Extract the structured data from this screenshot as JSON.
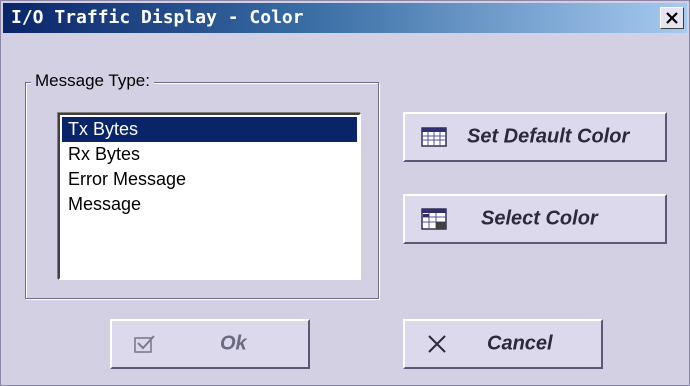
{
  "window": {
    "title": "I/O Traffic Display - Color"
  },
  "group": {
    "label": "Message Type:"
  },
  "list": {
    "items": [
      "Tx Bytes",
      "Rx Bytes",
      "Error Message",
      "Message"
    ],
    "selected": "Tx Bytes"
  },
  "buttons": {
    "set_default_color": "Set Default Color",
    "select_color": "Select Color",
    "ok": "Ok",
    "cancel": "Cancel"
  },
  "icons": {
    "close": "close-icon",
    "set_default_color": "color-grid-icon",
    "select_color": "color-grid-select-icon",
    "ok": "checkmark-icon",
    "cancel": "x-icon"
  },
  "colors": {
    "title_start": "#0a246a",
    "title_end": "#a6caf0",
    "dialog_bg": "#d4d0e4",
    "selection": "#0a246a"
  }
}
